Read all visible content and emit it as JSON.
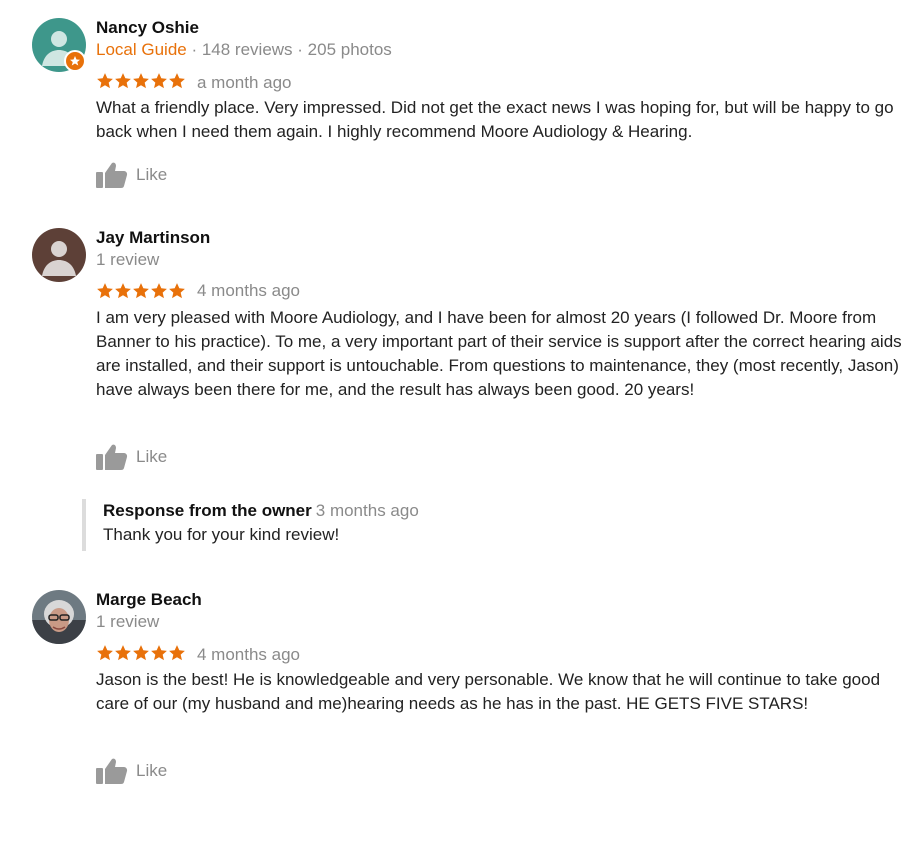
{
  "colors": {
    "star": "#e8710a",
    "local_guide": "#e8710a",
    "muted": "#8a8a8a"
  },
  "reviews": [
    {
      "name": "Nancy Oshie",
      "local_guide": "Local Guide",
      "stats": " · 148 reviews · 205 photos",
      "rating": 5,
      "date": "a month ago",
      "text": "What a friendly place. Very impressed. Did not get the exact news I was hoping for, but will be happy to go back when I need them again. I highly recommend Moore Audiology & Hearing.",
      "like_label": "Like",
      "avatar_icon": "person-avatar-icon"
    },
    {
      "name": "Jay Martinson",
      "stats": "1 review",
      "rating": 5,
      "date": "4 months ago",
      "text": "I am very pleased with Moore Audiology, and I have been for almost 20 years (I followed Dr. Moore from Banner to his practice). To me, a very  important part of their service is support after the correct hearing aids are installed, and their support is untouchable. From questions to maintenance, they (most recently, Jason) have always been there for me, and the result has always been good. 20 years!",
      "like_label": "Like",
      "avatar_icon": "person-avatar-icon",
      "owner_response": {
        "title": "Response from the owner",
        "date": "3 months ago",
        "text": "Thank you for your kind review!"
      }
    },
    {
      "name": "Marge Beach",
      "stats": "1 review",
      "rating": 5,
      "date": "4 months ago",
      "text": "Jason is the best!  He is knowledgeable and very personable. We know that he will continue to take good care of our (my husband and me)hearing needs as he has in the past.  HE GETS FIVE STARS!",
      "like_label": "Like",
      "avatar_icon": "profile-photo"
    }
  ]
}
